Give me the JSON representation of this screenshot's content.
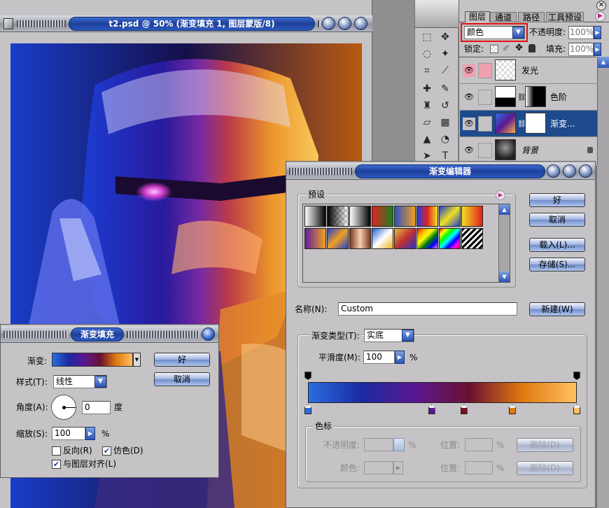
{
  "document": {
    "title": "t2.psd @ 50% (渐变填充 1, 图层蒙版/8)"
  },
  "gradient_fill": {
    "title": "渐变填充",
    "gradient_label": "渐变:",
    "style_label": "样式(T):",
    "style_value": "线性",
    "angle_label": "角度(A):",
    "angle_value": "0",
    "angle_unit": "度",
    "scale_label": "缩放(S):",
    "scale_value": "100",
    "scale_unit": "%",
    "reverse_label": "反向(R)",
    "reverse_checked": false,
    "dither_label": "仿色(D)",
    "dither_checked": true,
    "align_label": "与图层对齐(L)",
    "align_checked": true,
    "ok_label": "好",
    "cancel_label": "取消"
  },
  "layers_panel": {
    "tabs": [
      "图层",
      "通道",
      "路径",
      "工具预设"
    ],
    "blend_mode": "颜色",
    "opacity_label": "不透明度:",
    "opacity_value": "100%",
    "lock_label": "锁定:",
    "fill_label": "填充:",
    "fill_value": "100%",
    "layers": [
      {
        "name": "发光",
        "visible": true,
        "selected": false
      },
      {
        "name": "色阶",
        "visible": true,
        "selected": false
      },
      {
        "name": "渐变...",
        "visible": true,
        "selected": true
      },
      {
        "name": "背景",
        "visible": true,
        "selected": false,
        "locked": true
      }
    ]
  },
  "gradient_editor": {
    "title": "渐变编辑器",
    "presets_label": "预设",
    "ok_label": "好",
    "cancel_label": "取消",
    "load_label": "载入(L)...",
    "save_label": "存储(S)...",
    "name_label": "名称(N):",
    "name_value": "Custom",
    "new_label": "新建(W)",
    "type_label": "渐变类型(T):",
    "type_value": "实底",
    "smooth_label": "平滑度(M):",
    "smooth_value": "100",
    "smooth_unit": "%",
    "stops_group_label": "色标",
    "opacity_label": "不透明度:",
    "opacity_unit": "%",
    "location_label": "位置:",
    "location_unit": "%",
    "delete_label": "删除(D)",
    "color_label": "颜色:",
    "color_location_label": "位置:",
    "color_location_unit": "%",
    "color_delete_label": "删除(D)",
    "gradient_colors": [
      "#2a6de0",
      "#1a2aa0",
      "#5a1890",
      "#6a1030",
      "#e07a10",
      "#ffc060"
    ],
    "color_stops": [
      {
        "position": 0,
        "color": "#2a6de0"
      },
      {
        "position": 46,
        "color": "#5a1890"
      },
      {
        "position": 58,
        "color": "#7a1020"
      },
      {
        "position": 76,
        "color": "#e07a10"
      },
      {
        "position": 100,
        "color": "#ffc060"
      }
    ],
    "opacity_stops": [
      0,
      100
    ]
  }
}
